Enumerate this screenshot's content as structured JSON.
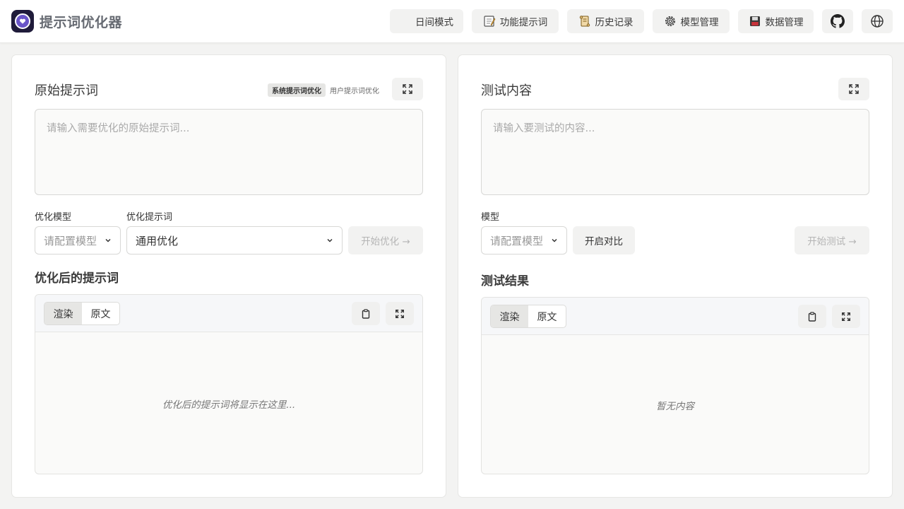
{
  "app": {
    "title": "提示词优化器"
  },
  "header": {
    "buttons": [
      {
        "label": "日间模式",
        "icon": "moon-icon"
      },
      {
        "label": "功能提示词",
        "icon": "memo-icon"
      },
      {
        "label": "历史记录",
        "icon": "scroll-icon"
      },
      {
        "label": "模型管理",
        "icon": "gear-icon"
      },
      {
        "label": "数据管理",
        "icon": "floppy-disk-icon"
      }
    ],
    "icon_buttons": [
      "github-icon",
      "globe-icon"
    ]
  },
  "left": {
    "title": "原始提示词",
    "mode_active": "系统提示词优化",
    "mode_inactive": "用户提示词优化",
    "input_placeholder": "请输入需要优化的原始提示词...",
    "model_label": "优化模型",
    "model_value": "请配置模型",
    "template_label": "优化提示词",
    "template_value": "通用优化",
    "start_button": "开始优化 →",
    "output_title": "优化后的提示词",
    "tab_render": "渲染",
    "tab_raw": "原文",
    "output_empty": "优化后的提示词将显示在这里..."
  },
  "right": {
    "title": "测试内容",
    "input_placeholder": "请输入要测试的内容...",
    "model_label": "模型",
    "model_value": "请配置模型",
    "compare_button": "开启对比",
    "start_button": "开始测试 →",
    "output_title": "测试结果",
    "tab_render": "渲染",
    "tab_raw": "原文",
    "output_empty": "暂无内容"
  },
  "colors": {
    "page_bg": "#f3f3f2",
    "panel_bg": "#ffffff",
    "button_bg": "#f2f2f1",
    "logo_bg": "#1f1b3a",
    "logo_accent": "#6a55c8",
    "disabled_text": "#b5b5b5"
  }
}
